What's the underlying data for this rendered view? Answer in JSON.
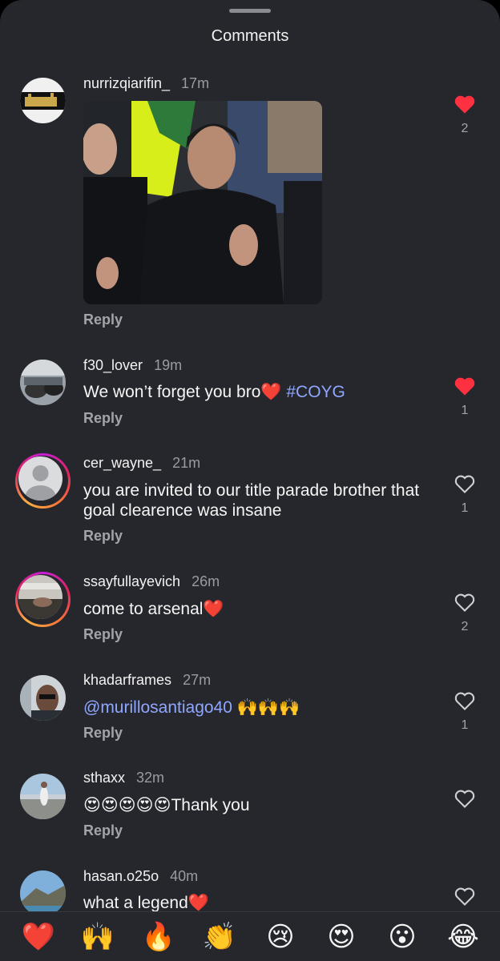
{
  "header": {
    "title": "Comments"
  },
  "comments": [
    {
      "user": "nurrizqiarifin_",
      "time": "17m",
      "text": "",
      "reply": "Reply",
      "likes": "2",
      "liked": true,
      "image": "clapping-manager-gif"
    },
    {
      "user": "f30_lover",
      "time": "19m",
      "text": "We won’t forget you bro❤️ ",
      "tag": "#COYG",
      "reply": "Reply",
      "likes": "1",
      "liked": true
    },
    {
      "user": "cer_wayne_",
      "time": "21m",
      "text": "you are invited to our title parade brother that goal clearence was insane",
      "reply": "Reply",
      "likes": "1",
      "liked": false
    },
    {
      "user": "ssayfullayevich",
      "time": "26m",
      "text": "come to arsenal❤️",
      "reply": "Reply",
      "likes": "2",
      "liked": false
    },
    {
      "user": "khadarframes",
      "time": "27m",
      "mention": "@murillosantiago40",
      "text": " 🙌🙌🙌",
      "reply": "Reply",
      "likes": "1",
      "liked": false
    },
    {
      "user": "sthaxx",
      "time": "32m",
      "text": "😍😍😍😍😍Thank you",
      "reply": "Reply",
      "likes": "",
      "liked": false
    },
    {
      "user": "hasan.o25o",
      "time": "40m",
      "text": "what a legend❤️",
      "reply": "",
      "likes": "",
      "liked": false
    }
  ],
  "reactions": [
    "❤️",
    "🙌",
    "🔥",
    "👏",
    "😢",
    "😍",
    "😮",
    "😂"
  ],
  "colors": {
    "background": "#26272c",
    "like_red": "#ff3040",
    "link": "#8fa7ff"
  }
}
